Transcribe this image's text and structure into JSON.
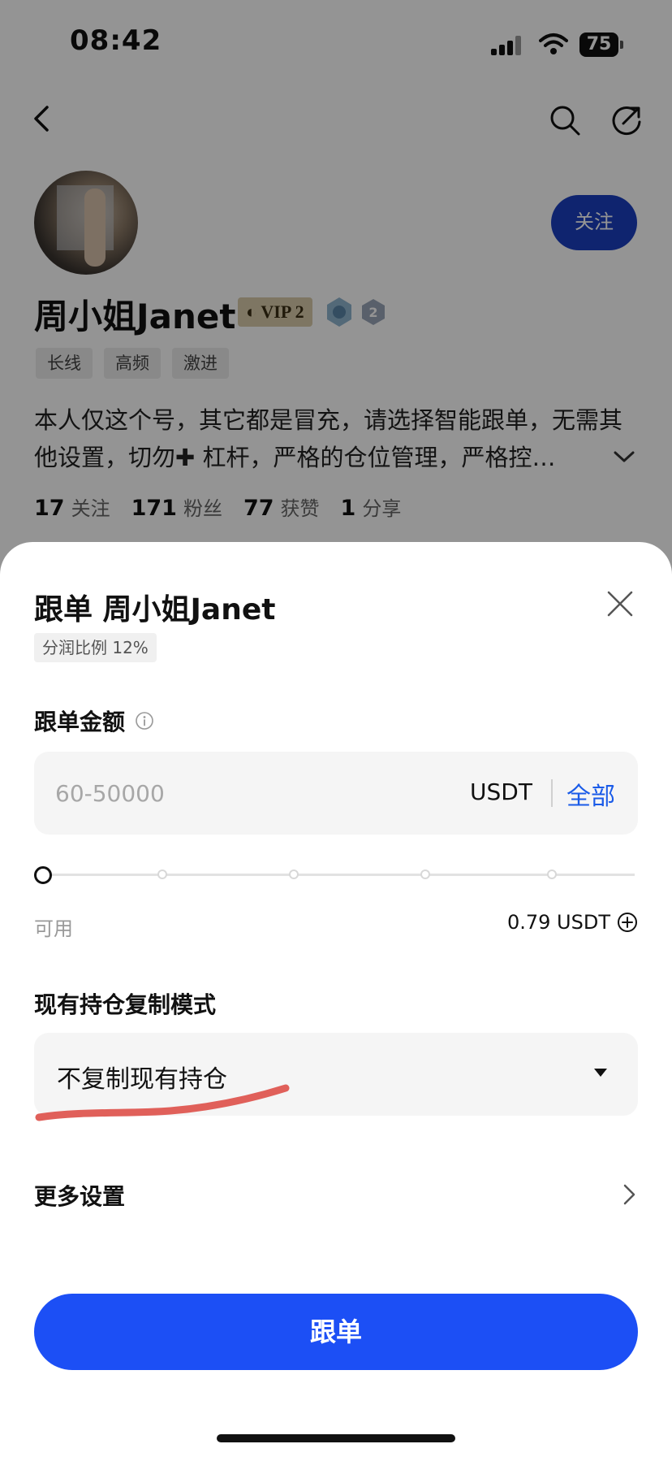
{
  "status_bar": {
    "time": "08:42",
    "battery": "75"
  },
  "profile": {
    "follow_label": "关注",
    "name": "周小姐Janet",
    "vip": "VIP 2",
    "medal_level": "2",
    "tags": [
      "长线",
      "高频",
      "激进"
    ],
    "bio": "本人仅这个号，其它都是冒充，请选择智能跟单，无需其他设置，切勿✚ 杠杆，严格的仓位管理，严格控…",
    "stats": [
      {
        "value": "17",
        "label": "关注"
      },
      {
        "value": "171",
        "label": "粉丝"
      },
      {
        "value": "77",
        "label": "获赞"
      },
      {
        "value": "1",
        "label": "分享"
      }
    ]
  },
  "sheet": {
    "title": "跟单 周小姐Janet",
    "share_ratio": "分润比例 12%",
    "amount_label": "跟单金额",
    "amount_placeholder": "60-50000",
    "amount_value": "",
    "unit": "USDT",
    "all_label": "全部",
    "slider_value": 0,
    "available_label": "可用",
    "available_value": "0.79 USDT",
    "mode_label": "现有持仓复制模式",
    "mode_value": "不复制现有持仓",
    "more_settings": "更多设置",
    "submit": "跟单"
  },
  "colors": {
    "accent": "#1c4ff5",
    "follow_button": "#1a3fbf",
    "link": "#1a5be8",
    "annotation": "#e0605a"
  }
}
